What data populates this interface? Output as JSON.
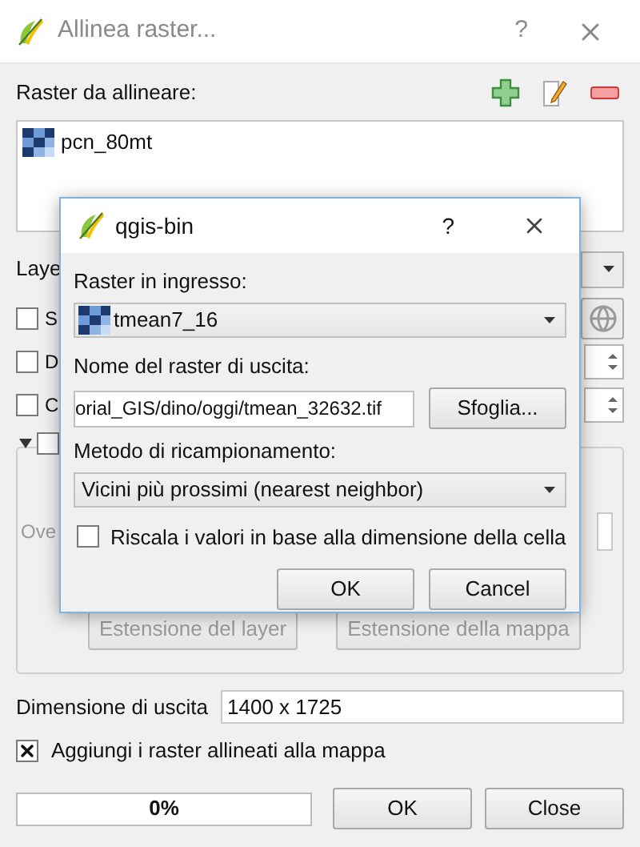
{
  "main_window": {
    "title": "Allinea raster...",
    "help": "?",
    "raster_list": {
      "label": "Raster da allineare:",
      "items": [
        {
          "name": "pcn_80mt",
          "selected": false
        }
      ]
    },
    "layer_label": "Laye",
    "options": [
      {
        "label": "S",
        "checked": false,
        "kind": "button"
      },
      {
        "label": "D",
        "checked": false,
        "kind": "spin"
      },
      {
        "label": "C",
        "checked": false,
        "kind": "spin"
      }
    ],
    "extent_group": {
      "expanded": true,
      "checked": false,
      "disabled": true,
      "row_label": "Ove",
      "buttons": [
        "Estensione del layer",
        "Estensione della mappa"
      ]
    },
    "output_size": {
      "label": "Dimensione di uscita",
      "value": "1400 x 1725"
    },
    "add_to_map": {
      "label": "Aggiungi i raster allineati alla mappa",
      "checked": true
    },
    "progress": {
      "level": 0,
      "text": "0%"
    },
    "buttons": [
      "OK",
      "Close"
    ]
  },
  "dialog": {
    "title": "qgis-bin",
    "help": "?",
    "input_label": "Raster in ingresso:",
    "input_value": "tmean7_16",
    "output_label": "Nome del raster di uscita:",
    "output_value": "orial_GIS/dino/oggi/tmean_32632.tif",
    "browse": "Sfoglia...",
    "method_label": "Metodo di ricampionamento:",
    "method_value": "Vicini più prossimi (nearest neighbor)",
    "rescale": {
      "label": "Riscala i valori in base alla dimensione della cella",
      "checked": false
    },
    "buttons": [
      "OK",
      "Cancel"
    ]
  }
}
